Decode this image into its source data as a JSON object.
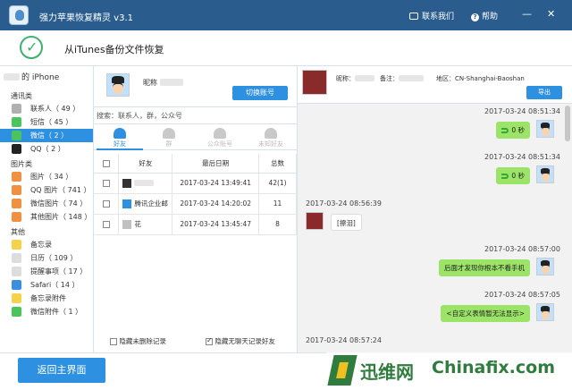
{
  "app": {
    "title": "强力苹果恢复精灵 v3.1",
    "contact": "联系我们",
    "help": "帮助",
    "help_glyph": "?",
    "minimize": "—",
    "close": "✕"
  },
  "header": {
    "title": "从iTunes备份文件恢复"
  },
  "sidebar": {
    "device": "的 iPhone",
    "groups": [
      {
        "label": "通讯类",
        "items": [
          {
            "label": "联系人（ 49 ）",
            "icon": "contacts-icon",
            "color": "#b0b0b0"
          },
          {
            "label": "短信（ 45 ）",
            "icon": "sms-icon",
            "color": "#4cc45c"
          },
          {
            "label": "微信（ 2 ）",
            "icon": "wechat-icon",
            "color": "#4cc45c",
            "selected": true
          },
          {
            "label": "QQ（ 2 ）",
            "icon": "qq-icon",
            "color": "#222222"
          }
        ]
      },
      {
        "label": "图片类",
        "items": [
          {
            "label": "图片（ 34 ）",
            "icon": "photos-icon",
            "color": "#f09040"
          },
          {
            "label": "QQ 图片（ 741 ）",
            "icon": "qq-photos-icon",
            "color": "#f09040"
          },
          {
            "label": "微信图片（ 74 ）",
            "icon": "wechat-photos-icon",
            "color": "#f09040"
          },
          {
            "label": "其他图片（ 148 ）",
            "icon": "other-photos-icon",
            "color": "#f09040"
          }
        ]
      },
      {
        "label": "其他",
        "items": [
          {
            "label": "备忘录",
            "icon": "notes-icon",
            "color": "#f5d24a"
          },
          {
            "label": "日历（ 109 ）",
            "icon": "calendar-icon",
            "color": "#dddddd"
          },
          {
            "label": "提醒事项（ 17 ）",
            "icon": "reminders-icon",
            "color": "#dddddd"
          },
          {
            "label": "Safari（ 14 ）",
            "icon": "safari-icon",
            "color": "#3b8fe0"
          },
          {
            "label": "备忘录附件",
            "icon": "notes-attachment-icon",
            "color": "#f5d24a"
          },
          {
            "label": "微信附件（ 1 ）",
            "icon": "wechat-attachment-icon",
            "color": "#4cc45c"
          }
        ]
      }
    ]
  },
  "account": {
    "nick_label": "昵称",
    "switch_label": "切换账号"
  },
  "search": {
    "placeholder": "搜索：联系人，群，公众号"
  },
  "tabs": [
    {
      "label": "好友",
      "active": true
    },
    {
      "label": "群"
    },
    {
      "label": "公众账号"
    },
    {
      "label": "未知好友"
    }
  ],
  "table": {
    "headers": [
      "好友",
      "最后日期",
      "总数"
    ],
    "rows": [
      {
        "name": "",
        "date": "2017-03-24 13:49:41",
        "count": "42(1)"
      },
      {
        "name": "腾讯企业邮",
        "date": "2017-03-24 14:20:02",
        "count": "11"
      },
      {
        "name": "花",
        "date": "2017-03-24 13:45:47",
        "count": "8"
      }
    ]
  },
  "options": {
    "hide_deleted": "隐藏未删除记录",
    "hide_empty": "隐藏无聊天记录好友"
  },
  "chat": {
    "nick_label": "昵称：",
    "note_label": "备注：",
    "region": "地区：CN-Shanghai-Baoshan",
    "export_label": "导出",
    "messages": [
      {
        "time": "2017-03-24 08:51:34",
        "side": "me",
        "text": "0 秒"
      },
      {
        "time": "2017-03-24 08:51:34",
        "side": "me",
        "text": "0 秒"
      },
      {
        "time": "2017-03-24 08:56:39",
        "side": "other",
        "text": "[擦泪]"
      },
      {
        "time": "2017-03-24 08:57:00",
        "side": "me",
        "text": "后面才发现你根本不看手机"
      },
      {
        "time": "2017-03-24 08:57:05",
        "side": "me",
        "text": "<自定义表情暂无法显示>"
      },
      {
        "time": "2017-03-24 08:57:24"
      }
    ]
  },
  "bottom": {
    "back_label": "返回主界面"
  },
  "watermark": {
    "brand1": "迅维网",
    "brand2": "Chinafix.com"
  }
}
